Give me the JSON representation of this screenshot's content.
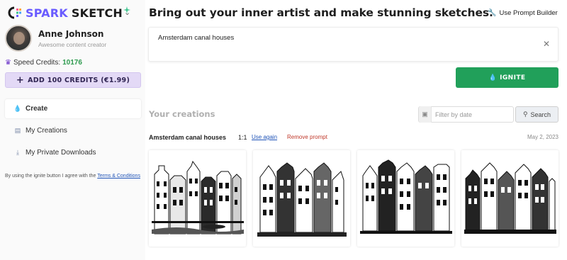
{
  "app": {
    "logo_spark": "SPARK",
    "logo_sketch": "SKETCH",
    "menu_chevron": "chevron-down-icon"
  },
  "profile": {
    "name": "Anne Johnson",
    "subtitle": "Awesome content creator"
  },
  "credits": {
    "label": "Speed Credits:",
    "value": "10176",
    "value_color": "#2c9a4d",
    "add_button": "ADD 100 CREDITS (€1.99)"
  },
  "nav": {
    "items": [
      {
        "label": "Create",
        "icon": "flame-icon",
        "active": true
      },
      {
        "label": "My Creations",
        "icon": "images-icon",
        "active": false
      },
      {
        "label": "My Private Downloads",
        "icon": "download-icon",
        "active": false
      }
    ]
  },
  "terms": {
    "text": "By using the ignite button I agree with the",
    "link": "Terms & Conditions"
  },
  "header": {
    "headline": "Bring out your inner artist and make stunning sketches.",
    "prompt_builder": "Use Prompt Builder"
  },
  "prompt": {
    "value": "Amsterdam canal houses"
  },
  "ignite": {
    "label": "IGNITE",
    "color": "#21a05a"
  },
  "creations": {
    "section_title": "Your creations",
    "filter_placeholder": "Filter by date",
    "search_label": "Search",
    "group": {
      "title": "Amsterdam canal houses",
      "ratio": "1:1",
      "use_again": "Use again",
      "remove": "Remove prompt",
      "date": "May 2, 2023",
      "thumbnails": [
        "sketch-image",
        "sketch-image",
        "sketch-image",
        "sketch-image"
      ]
    }
  }
}
